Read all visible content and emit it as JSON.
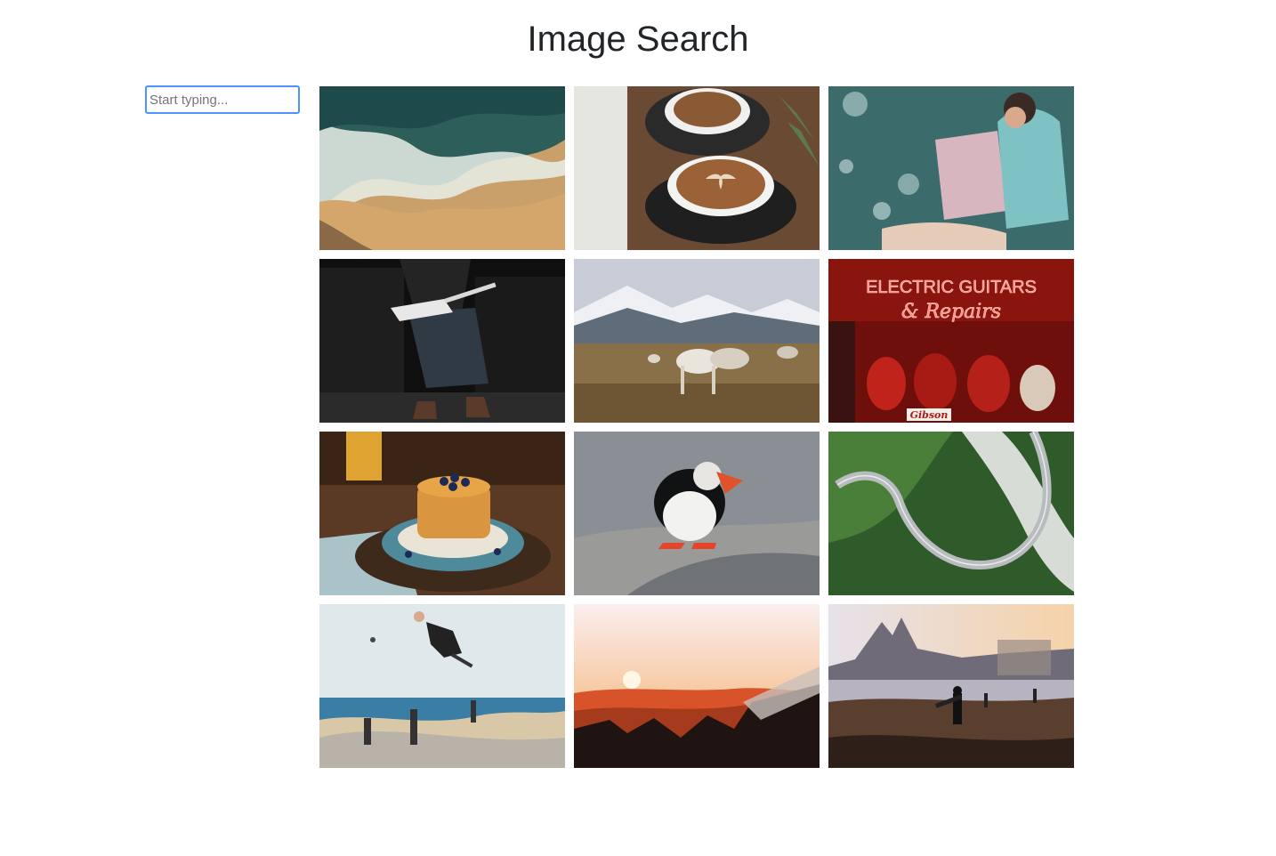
{
  "header": {
    "title": "Image Search"
  },
  "search": {
    "placeholder": "Start typing...",
    "value": ""
  },
  "images": [
    {
      "name": "beach-waves-image"
    },
    {
      "name": "coffee-cups-image"
    },
    {
      "name": "woman-with-magazine-image"
    },
    {
      "name": "guitarist-image"
    },
    {
      "name": "reindeer-image"
    },
    {
      "name": "electric-guitars-shop-image"
    },
    {
      "name": "pancakes-image"
    },
    {
      "name": "puffin-image"
    },
    {
      "name": "winding-road-image"
    },
    {
      "name": "skateboarder-image"
    },
    {
      "name": "sunset-mountains-image"
    },
    {
      "name": "beach-surfer-image"
    }
  ],
  "sign_text": {
    "line1": "ELECTRIC GUITARS",
    "line2": "& Repairs",
    "brand": "Gibson"
  }
}
